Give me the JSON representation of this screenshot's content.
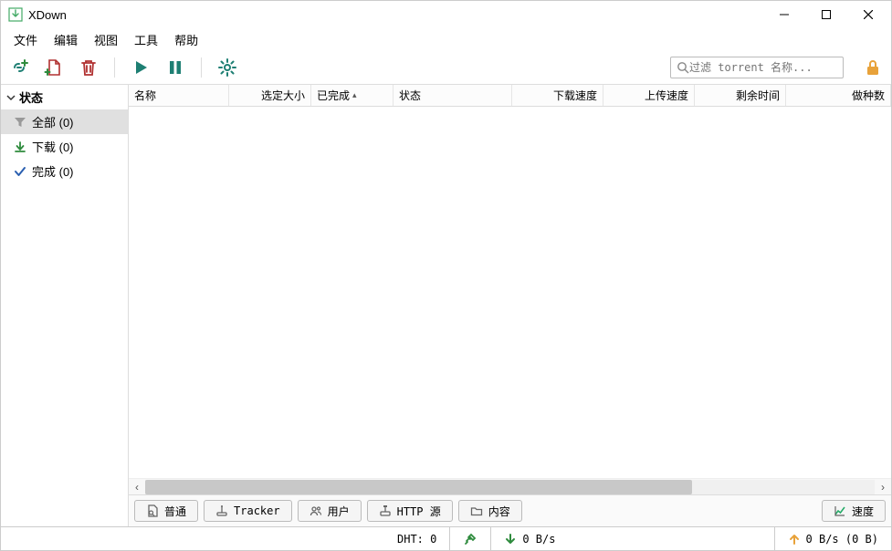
{
  "window": {
    "title": "XDown"
  },
  "menu": {
    "file": "文件",
    "edit": "编辑",
    "view": "视图",
    "tools": "工具",
    "help": "帮助"
  },
  "search": {
    "placeholder": "过滤 torrent 名称..."
  },
  "sidebar": {
    "header": "状态",
    "items": [
      {
        "label": "全部 (0)",
        "icon": "filter"
      },
      {
        "label": "下载 (0)",
        "icon": "download"
      },
      {
        "label": "完成 (0)",
        "icon": "check"
      }
    ]
  },
  "columns": {
    "name": "名称",
    "selected_size": "选定大小",
    "completed": "已完成",
    "status": "状态",
    "down_speed": "下载速度",
    "up_speed": "上传速度",
    "eta": "剩余时间",
    "seeds": "做种数"
  },
  "tabs": {
    "general": "普通",
    "tracker": "Tracker",
    "peers": "用户",
    "http": "HTTP 源",
    "content": "内容",
    "speed": "速度"
  },
  "status": {
    "dht": "DHT: 0",
    "down": "0 B/s",
    "up": "0 B/s (0 B)"
  },
  "colors": {
    "green": "#2e8b3d",
    "orange": "#e8a23a",
    "red": "#b03030",
    "teal": "#1e7f73",
    "gray": "#888"
  }
}
